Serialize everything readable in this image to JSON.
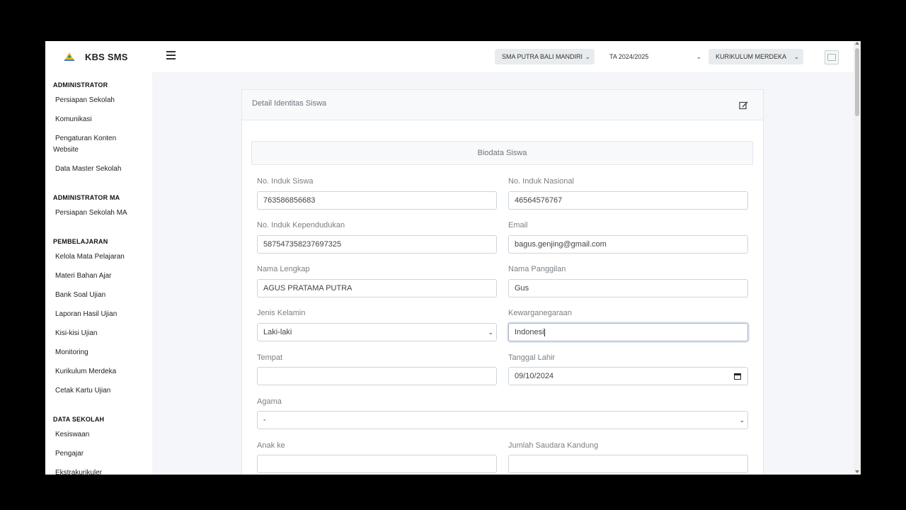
{
  "app": {
    "name": "KBS SMS"
  },
  "sidebar": {
    "sections": [
      {
        "heading": "ADMINISTRATOR",
        "items": [
          "Persiapan Sekolah",
          "Komunikasi",
          "Pengaturan Konten Website",
          "Data Master Sekolah"
        ]
      },
      {
        "heading": "ADMINISTRATOR MA",
        "items": [
          "Persiapan Sekolah MA"
        ]
      },
      {
        "heading": "PEMBELAJARAN",
        "items": [
          "Kelola Mata Pelajaran",
          "Materi Bahan Ajar",
          "Bank Soal Ujian",
          "Laporan Hasil Ujian",
          "Kisi-kisi Ujian",
          "Monitoring",
          "Kurikulum Merdeka",
          "Cetak Kartu Ujian"
        ]
      },
      {
        "heading": "DATA SEKOLAH",
        "items": [
          "Kesiswaan",
          "Pengajar",
          "Ekstrakurikuler"
        ]
      }
    ]
  },
  "topbar": {
    "school": "SMA PUTRA BALI MANDIRI",
    "year": "TA 2024/2025",
    "curriculum": "KURIKULUM MERDEKA"
  },
  "card": {
    "title": "Detail Identitas Siswa",
    "section_title": "Biodata Siswa"
  },
  "form": {
    "nis": {
      "label": "No. Induk Siswa",
      "value": "763586856683"
    },
    "nisn": {
      "label": "No. Induk Nasional",
      "value": "46564576767"
    },
    "nik": {
      "label": "No. Induk Kependudukan",
      "value": "587547358237697325"
    },
    "email": {
      "label": "Email",
      "value": "bagus.genjing@gmail.com"
    },
    "nama_lengkap": {
      "label": "Nama Lengkap",
      "value": "AGUS PRATAMA PUTRA"
    },
    "nama_panggilan": {
      "label": "Nama Panggilan",
      "value": "Gus"
    },
    "jenis_kelamin": {
      "label": "Jenis Kelamin",
      "value": "Laki-laki"
    },
    "kewarganegaraan": {
      "label": "Kewarganegaraan",
      "value": "Indonesi"
    },
    "tempat": {
      "label": "Tempat",
      "value": ""
    },
    "tanggal_lahir": {
      "label": "Tanggal Lahir",
      "value": "09/10/2024"
    },
    "agama": {
      "label": "Agama",
      "value": "-"
    },
    "anak_ke": {
      "label": "Anak ke",
      "value": ""
    },
    "jumlah_saudara": {
      "label": "Jumlah Saudara Kandung",
      "value": ""
    }
  },
  "icons": [
    "logo-icon",
    "hamburger-icon",
    "chevron-down-icon",
    "avatar-image",
    "edit-icon",
    "calendar-icon"
  ]
}
